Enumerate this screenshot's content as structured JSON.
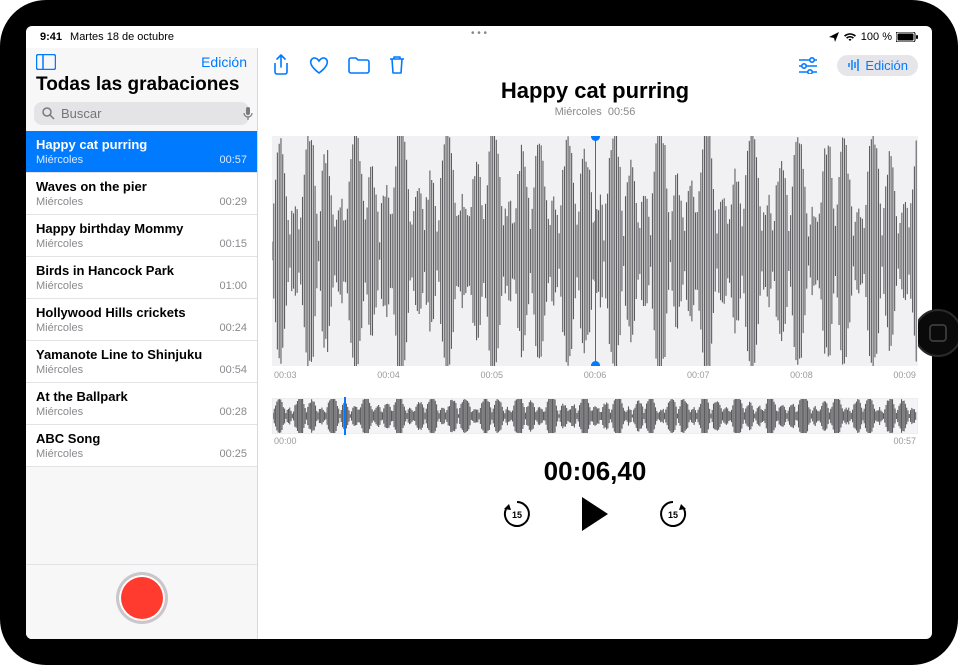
{
  "status": {
    "time": "9:41",
    "date": "Martes 18 de octubre",
    "battery_pct": "100 %"
  },
  "sidebar": {
    "edit_label": "Edición",
    "title": "Todas las grabaciones",
    "search_placeholder": "Buscar"
  },
  "recordings": [
    {
      "title": "Happy cat purring",
      "day": "Miércoles",
      "dur": "00:57",
      "selected": true
    },
    {
      "title": "Waves on the pier",
      "day": "Miércoles",
      "dur": "00:29"
    },
    {
      "title": "Happy birthday Mommy",
      "day": "Miércoles",
      "dur": "00:15"
    },
    {
      "title": "Birds in Hancock Park",
      "day": "Miércoles",
      "dur": "01:00"
    },
    {
      "title": "Hollywood Hills crickets",
      "day": "Miércoles",
      "dur": "00:24"
    },
    {
      "title": "Yamanote Line to Shinjuku",
      "day": "Miércoles",
      "dur": "00:54"
    },
    {
      "title": "At the Ballpark",
      "day": "Miércoles",
      "dur": "00:28"
    },
    {
      "title": "ABC Song",
      "day": "Miércoles",
      "dur": "00:25"
    }
  ],
  "detail": {
    "title": "Happy cat purring",
    "subtitle_day": "Miércoles",
    "subtitle_dur": "00:56",
    "edit_label": "Edición",
    "main_ticks": [
      "00:03",
      "00:04",
      "00:05",
      "00:06",
      "00:07",
      "00:08",
      "00:09"
    ],
    "mini_start": "00:00",
    "mini_end": "00:57",
    "current_time": "00:06,40"
  },
  "colors": {
    "accent": "#007aff",
    "record": "#ff3b30"
  }
}
